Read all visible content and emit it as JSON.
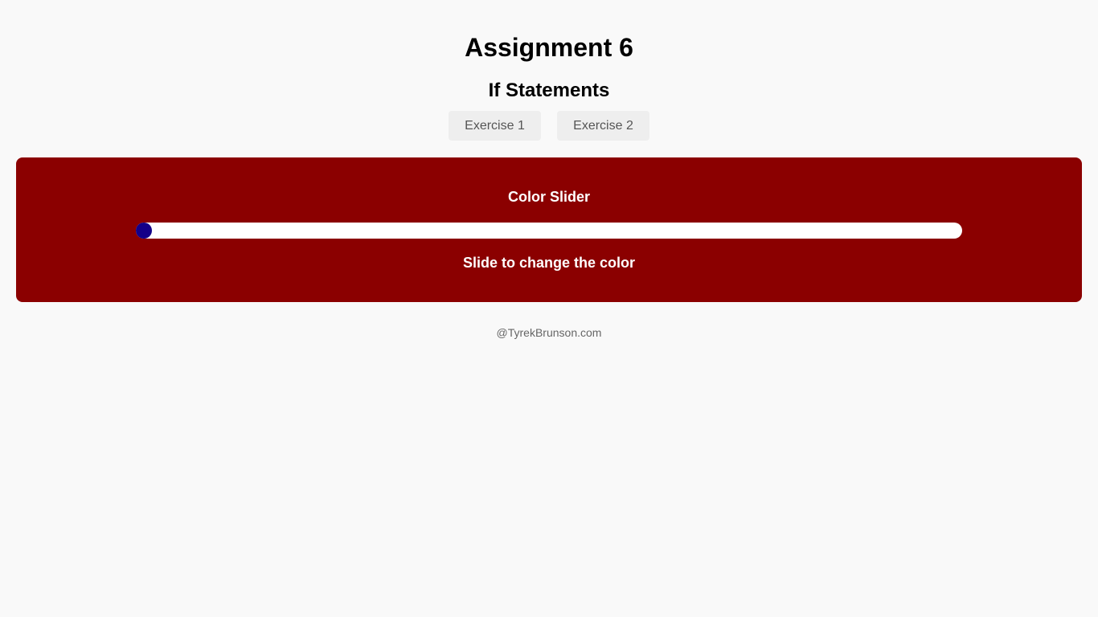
{
  "header": {
    "title": "Assignment 6",
    "subtitle": "If Statements"
  },
  "tabs": [
    {
      "label": "Exercise 1"
    },
    {
      "label": "Exercise 2"
    }
  ],
  "panel": {
    "title": "Color Slider",
    "caption": "Slide to change the color",
    "background_color": "#8b0000",
    "slider": {
      "value_fraction": 0.0,
      "track_color": "#ffffff",
      "thumb_color": "#140088"
    }
  },
  "footer": {
    "text": "@TyrekBrunson.com"
  }
}
